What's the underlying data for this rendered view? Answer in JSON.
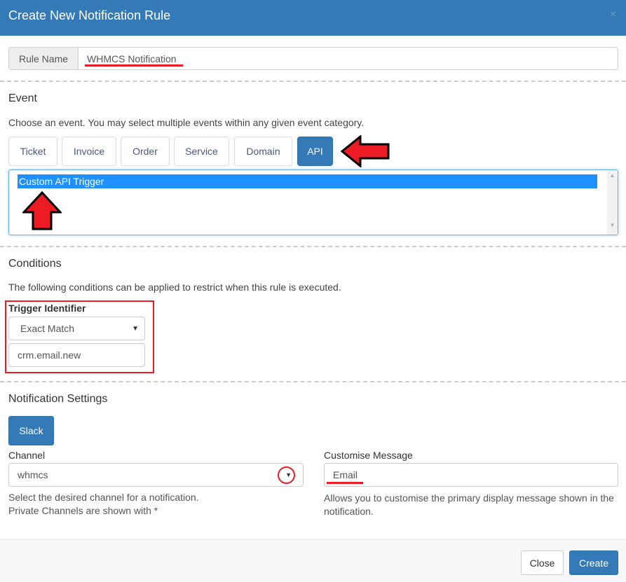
{
  "modal": {
    "title": "Create New Notification Rule",
    "close_icon": "×"
  },
  "rule_name": {
    "label": "Rule Name",
    "value": "WHMCS Notification"
  },
  "event": {
    "heading": "Event",
    "description": "Choose an event. You may select multiple events within any given event category.",
    "tabs": [
      {
        "label": "Ticket"
      },
      {
        "label": "Invoice"
      },
      {
        "label": "Order"
      },
      {
        "label": "Service"
      },
      {
        "label": "Domain"
      },
      {
        "label": "API",
        "active": true
      }
    ],
    "options": [
      {
        "label": "Custom API Trigger",
        "selected": true
      }
    ]
  },
  "conditions": {
    "heading": "Conditions",
    "description": "The following conditions can be applied to restrict when this rule is executed.",
    "trigger_label": "Trigger Identifier",
    "match_value": "Exact Match",
    "identifier_value": "crm.email.new"
  },
  "notification": {
    "heading": "Notification Settings",
    "provider_button": "Slack",
    "channel_label": "Channel",
    "channel_value": "whmcs",
    "channel_help_1": "Select the desired channel for a notification.",
    "channel_help_2": "Private Channels are shown with *",
    "message_label": "Customise Message",
    "message_value": "Email",
    "message_help": "Allows you to customise the primary display message shown in the notification."
  },
  "footer": {
    "close_label": "Close",
    "create_label": "Create"
  },
  "colors": {
    "primary": "#337ab7",
    "annotation": "#ed1c24",
    "selected_option": "#1e90ff"
  }
}
